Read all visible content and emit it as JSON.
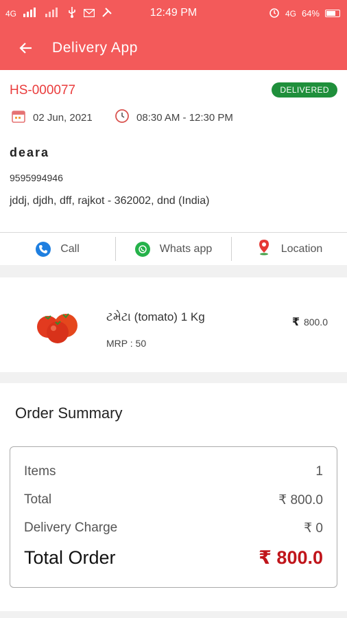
{
  "status_bar": {
    "network": "4G",
    "time": "12:49 PM",
    "network2": "4G",
    "battery": "64%"
  },
  "app_bar": {
    "title": "Delivery App",
    "back_icon": "arrow-left-icon"
  },
  "order": {
    "id": "HS-000077",
    "status": "DELIVERED",
    "date": "02 Jun, 2021",
    "time_slot": "08:30 AM - 12:30 PM",
    "customer_name": "deara",
    "phone": "9595994946",
    "address": "jddj, djdh, dff, rajkot - 362002, dnd (India)"
  },
  "actions": [
    {
      "label": "Call",
      "icon": "phone-icon",
      "color": "#1f7fe0"
    },
    {
      "label": "Whats app",
      "icon": "whatsapp-icon",
      "color": "#25b24a"
    },
    {
      "label": "Location",
      "icon": "location-pin-icon",
      "color": "#e53935"
    }
  ],
  "product": {
    "name": "ટમેટા (tomato) 1 Kg",
    "mrp": "MRP : 50",
    "currency": "₹",
    "price": "800.0"
  },
  "summary": {
    "title": "Order Summary",
    "items_label": "Items",
    "items_value": "1",
    "total_label": "Total",
    "total_value": "₹ 800.0",
    "delivery_label": "Delivery Charge",
    "delivery_value": "₹ 0",
    "order_total_label": "Total Order",
    "order_total_value": "₹ 800.0"
  },
  "colors": {
    "primary": "#f35a5a",
    "order_id": "#ea3c3c",
    "delivered_badge": "#1f8f3b",
    "total_red": "#c0151b"
  }
}
